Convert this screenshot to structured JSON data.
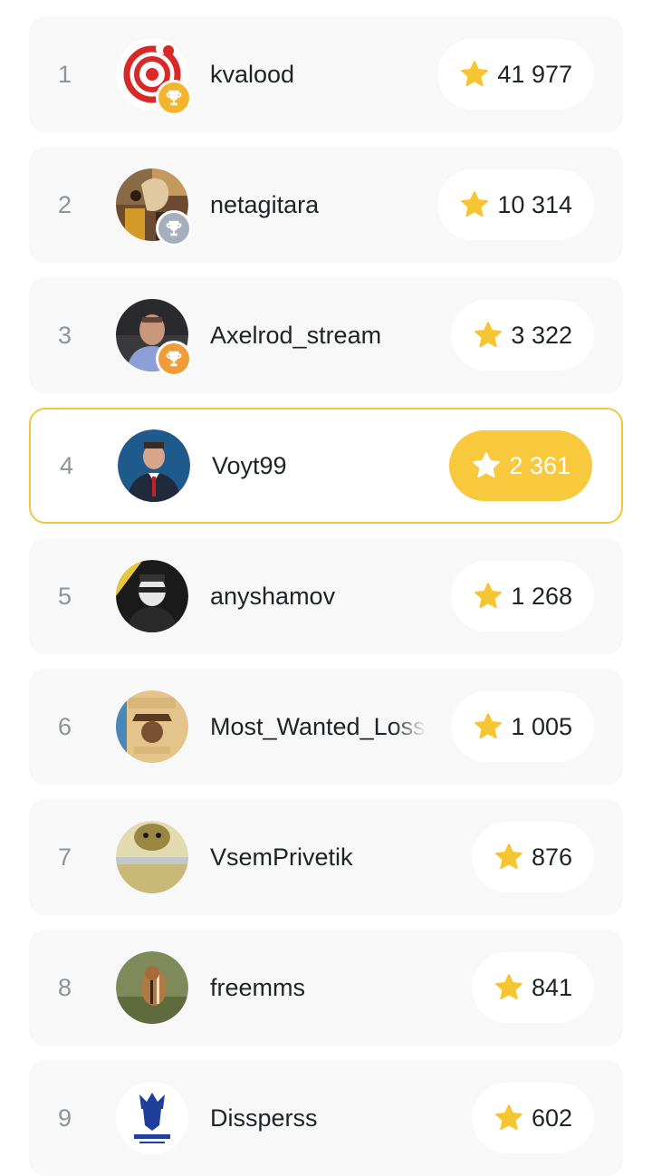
{
  "leaderboard": {
    "rows": [
      {
        "rank": "1",
        "name": "kvalood",
        "score": "41 977",
        "trophy": "gold"
      },
      {
        "rank": "2",
        "name": "netagitara",
        "score": "10 314",
        "trophy": "silver"
      },
      {
        "rank": "3",
        "name": "Axelrod_stream",
        "score": "3 322",
        "trophy": "bronze"
      },
      {
        "rank": "4",
        "name": "Voyt99",
        "score": "2 361",
        "current_user": true
      },
      {
        "rank": "5",
        "name": "anyshamov",
        "score": "1 268"
      },
      {
        "rank": "6",
        "name": "Most_Wanted_Loss",
        "score": "1 005"
      },
      {
        "rank": "7",
        "name": "VsemPrivetik",
        "score": "876"
      },
      {
        "rank": "8",
        "name": "freemms",
        "score": "841"
      },
      {
        "rank": "9",
        "name": "Dissperss",
        "score": "602"
      }
    ]
  },
  "icons": {
    "score": "star-icon",
    "badge": "trophy-icon"
  },
  "colors": {
    "accent": "#f8c93c",
    "star": "#f7c531",
    "trophy_gold": "#f3b52f",
    "trophy_silver": "#a6b0bd",
    "trophy_bronze": "#ef9d3a"
  }
}
